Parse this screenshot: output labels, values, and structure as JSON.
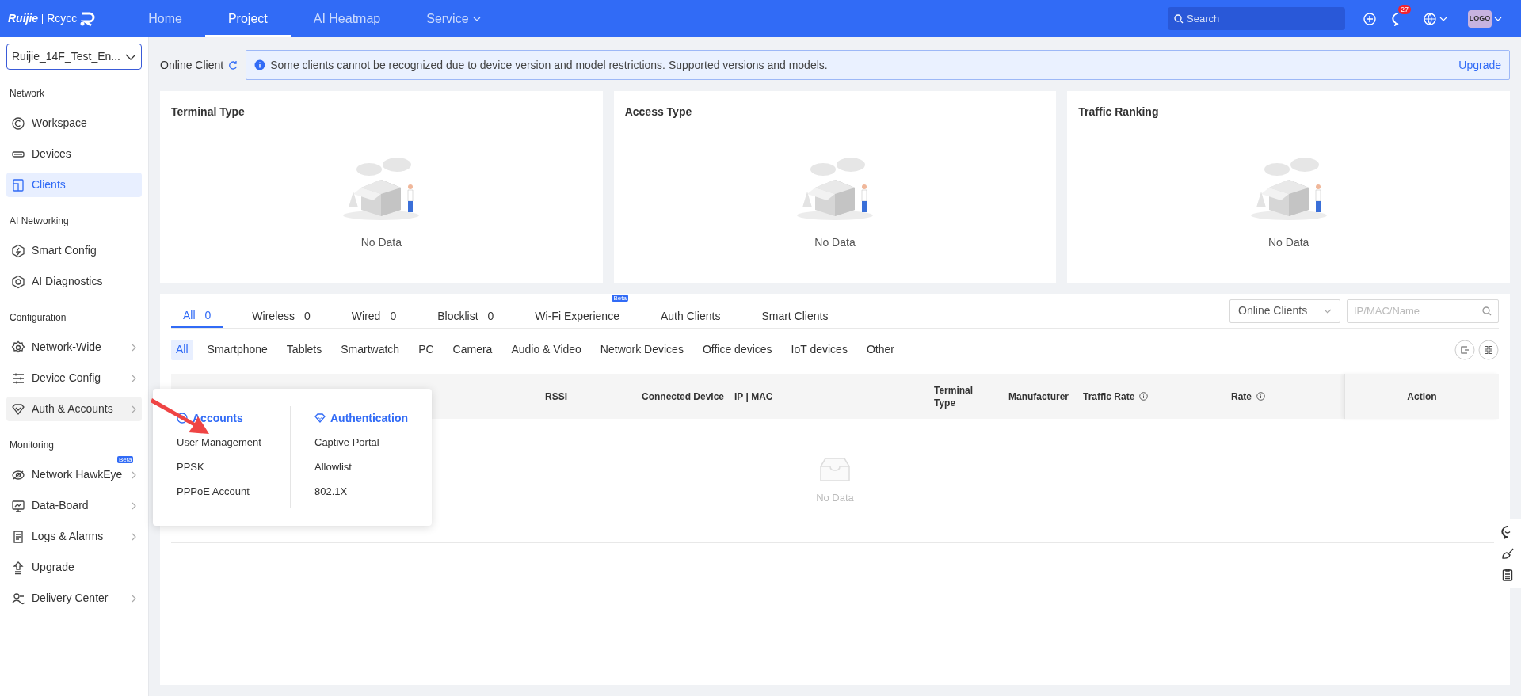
{
  "topbar": {
    "brand": "Ruijie",
    "product": "Rcycc",
    "nav": [
      {
        "label": "Home",
        "selected": false,
        "dropdown": false
      },
      {
        "label": "Project",
        "selected": true,
        "dropdown": false
      },
      {
        "label": "AI Heatmap",
        "selected": false,
        "dropdown": false
      },
      {
        "label": "Service",
        "selected": false,
        "dropdown": true
      }
    ],
    "search": {
      "placeholder": "Search"
    },
    "notifications": "27",
    "avatar": "LOGO"
  },
  "sidebar": {
    "project": "Ruijie_14F_Test_En...",
    "sections": [
      {
        "title": "Network",
        "items": [
          {
            "label": "Workspace",
            "selected": false,
            "hovered": false,
            "submenu": false
          },
          {
            "label": "Devices",
            "selected": false,
            "hovered": false,
            "submenu": false
          },
          {
            "label": "Clients",
            "selected": true,
            "hovered": false,
            "submenu": false
          }
        ]
      },
      {
        "title": "AI Networking",
        "items": [
          {
            "label": "Smart Config",
            "selected": false,
            "hovered": false,
            "submenu": false
          },
          {
            "label": "AI Diagnostics",
            "selected": false,
            "hovered": false,
            "submenu": false
          }
        ]
      },
      {
        "title": "Configuration",
        "items": [
          {
            "label": "Network-Wide",
            "selected": false,
            "hovered": false,
            "submenu": true
          },
          {
            "label": "Device Config",
            "selected": false,
            "hovered": false,
            "submenu": true
          },
          {
            "label": "Auth & Accounts",
            "selected": false,
            "hovered": true,
            "submenu": true
          }
        ]
      },
      {
        "title": "Monitoring",
        "items": [
          {
            "label": "Network HawkEye",
            "selected": false,
            "hovered": false,
            "submenu": true,
            "badge": "Beta"
          },
          {
            "label": "Data-Board",
            "selected": false,
            "hovered": false,
            "submenu": true
          },
          {
            "label": "Logs & Alarms",
            "selected": false,
            "hovered": false,
            "submenu": true
          },
          {
            "label": "Upgrade",
            "selected": false,
            "hovered": false,
            "submenu": false
          },
          {
            "label": "Delivery Center",
            "selected": false,
            "hovered": false,
            "submenu": true
          }
        ]
      }
    ]
  },
  "flyout": {
    "columns": [
      {
        "title": "Accounts",
        "items": [
          "User Management",
          "PPSK",
          "PPPoE Account"
        ]
      },
      {
        "title": "Authentication",
        "items": [
          "Captive Portal",
          "Allowlist",
          "802.1X"
        ]
      }
    ]
  },
  "header": {
    "title": "Online Client",
    "notice": "Some clients cannot be recognized due to device version and model restrictions. Supported versions and models.",
    "link": "Upgrade"
  },
  "cards": [
    {
      "title": "Terminal Type",
      "empty": "No Data"
    },
    {
      "title": "Access Type",
      "empty": "No Data"
    },
    {
      "title": "Traffic Ranking",
      "empty": "No Data"
    }
  ],
  "tabs": [
    {
      "label": "All",
      "count": "0",
      "selected": true
    },
    {
      "label": "Wireless",
      "count": "0",
      "selected": false
    },
    {
      "label": "Wired",
      "count": "0",
      "selected": false
    },
    {
      "label": "Blocklist",
      "count": "0",
      "selected": false
    },
    {
      "label": "Wi-Fi Experience",
      "badge": "Beta",
      "selected": false
    },
    {
      "label": "Auth Clients",
      "selected": false
    },
    {
      "label": "Smart Clients",
      "selected": false
    }
  ],
  "filter": {
    "value": "Online Clients",
    "placeholder": "IP/MAC/Name"
  },
  "categories": [
    {
      "label": "All",
      "selected": true
    },
    {
      "label": "Smartphone",
      "selected": false
    },
    {
      "label": "Tablets",
      "selected": false
    },
    {
      "label": "Smartwatch",
      "selected": false
    },
    {
      "label": "PC",
      "selected": false
    },
    {
      "label": "Camera",
      "selected": false
    },
    {
      "label": "Audio & Video",
      "selected": false
    },
    {
      "label": "Network Devices",
      "selected": false
    },
    {
      "label": "Office devices",
      "selected": false
    },
    {
      "label": "IoT devices",
      "selected": false
    },
    {
      "label": "Other",
      "selected": false
    }
  ],
  "table": {
    "columns": [
      {
        "label": "RSSI",
        "info": false
      },
      {
        "label": "Connected Device",
        "info": false
      },
      {
        "label": "IP | MAC",
        "info": false
      },
      {
        "label": "Terminal Type",
        "info": false
      },
      {
        "label": "Manufacturer",
        "info": false
      },
      {
        "label": "Traffic Rate",
        "info": true
      },
      {
        "label": "Rate",
        "info": true
      },
      {
        "label": "Action",
        "info": false
      }
    ],
    "empty": "No Data"
  }
}
